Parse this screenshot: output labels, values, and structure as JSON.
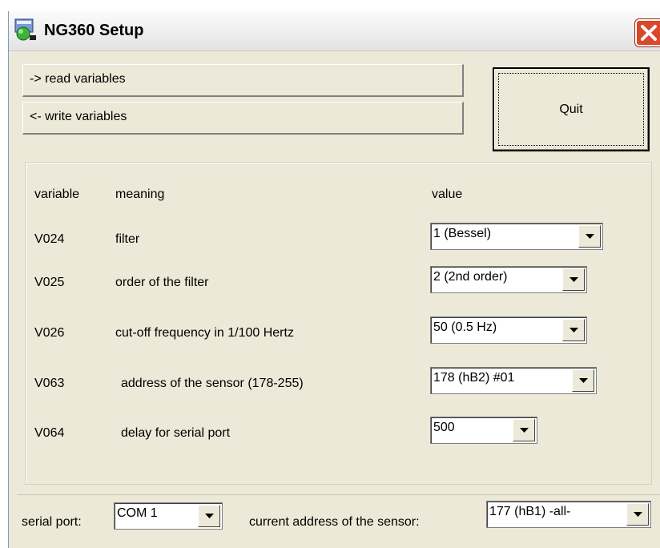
{
  "window": {
    "title": "NG360 Setup"
  },
  "buttons": {
    "read": "-> read variables",
    "write": "<- write variables",
    "quit": "Quit"
  },
  "table": {
    "headers": {
      "variable": "variable",
      "meaning": "meaning",
      "value": "value"
    },
    "rows": [
      {
        "variable": "V024",
        "meaning": "filter",
        "value": "1 (Bessel)"
      },
      {
        "variable": "V025",
        "meaning": "order of the filter",
        "value": "2 (2nd order)"
      },
      {
        "variable": "V026",
        "meaning": "cut-off frequency in 1/100 Hertz",
        "value": "50 (0.5 Hz)"
      },
      {
        "variable": "V063",
        "meaning": "address of the sensor (178-255)",
        "value": "178 (hB2) #01"
      },
      {
        "variable": "V064",
        "meaning": "delay for serial port",
        "value": "500"
      }
    ]
  },
  "footer": {
    "serial_port_label": "serial port:",
    "serial_port_value": "COM 1",
    "current_address_label": "current address of the sensor:",
    "current_address_value": "177 (hB1) -all-"
  }
}
